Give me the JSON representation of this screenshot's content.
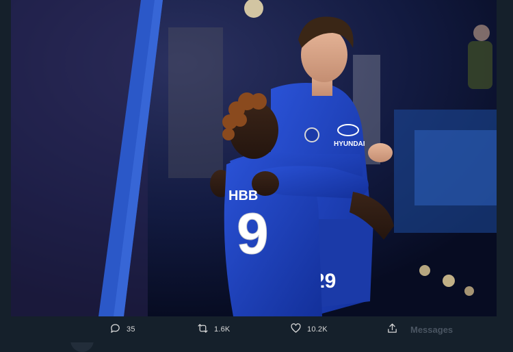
{
  "photo": {
    "jersey_number": "9",
    "back_name_partial": "HBB",
    "shorts_number": "29",
    "sponsor": "HYUNDAI",
    "colors": {
      "kit": "#1a3fb8",
      "background": "#0a1330",
      "app_background": "#15202b"
    }
  },
  "tweet_actions": {
    "reply": {
      "icon": "reply-icon",
      "count": "35"
    },
    "retweet": {
      "icon": "retweet-icon",
      "count": "1.6K"
    },
    "like": {
      "icon": "heart-icon",
      "count": "10.2K"
    },
    "share": {
      "icon": "share-icon"
    }
  },
  "messages_label": "Messages"
}
